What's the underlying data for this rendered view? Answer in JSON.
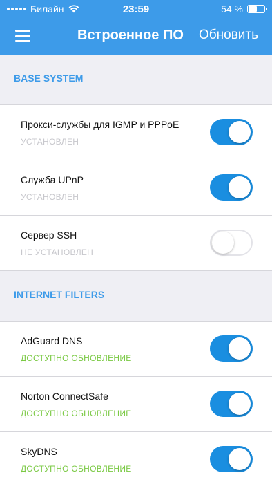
{
  "status_bar": {
    "carrier": "Билайн",
    "time": "23:59",
    "battery_percent": "54 %",
    "battery_level": 0.54
  },
  "nav": {
    "title": "Встроенное ПО",
    "action": "Обновить"
  },
  "sections": [
    {
      "title": "BASE SYSTEM",
      "items": [
        {
          "title": "Прокси-службы для IGMP и PPPoE",
          "status": "УСТАНОВЛЕН",
          "enabled": true
        },
        {
          "title": "Служба UPnP",
          "status": "УСТАНОВЛЕН",
          "enabled": true
        },
        {
          "title": "Сервер SSH",
          "status": "НЕ УСТАНОВЛЕН",
          "enabled": false
        }
      ]
    },
    {
      "title": "INTERNET FILTERS",
      "items": [
        {
          "title": "AdGuard DNS",
          "status": "ДОСТУПНО ОБНОВЛЕНИЕ",
          "enabled": true
        },
        {
          "title": "Norton ConnectSafe",
          "status": "ДОСТУПНО ОБНОВЛЕНИЕ",
          "enabled": true
        },
        {
          "title": "SkyDNS",
          "status": "ДОСТУПНО ОБНОВЛЕНИЕ",
          "enabled": true
        }
      ]
    }
  ]
}
